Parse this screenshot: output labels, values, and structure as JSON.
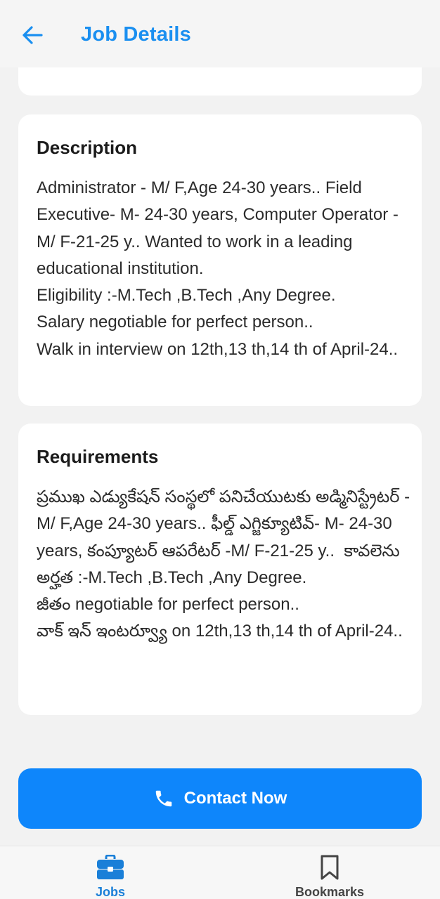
{
  "header": {
    "title": "Job Details",
    "back_icon": "arrow-left-icon",
    "accent": "#1a8ff0"
  },
  "description": {
    "heading": "Description",
    "text": "Administrator - M/ F,Age 24-30 years.. Field Executive- M- 24-30 years, Computer Operator -M/ F-21-25 y.. Wanted to work in a leading educational institution.\nEligibility :-M.Tech ,B.Tech ,Any Degree.\nSalary negotiable for perfect person..\nWalk in interview on 12th,13 th,14 th of April-24.."
  },
  "requirements": {
    "heading": "Requirements",
    "text": "ప్రముఖ ఎడ్యుకేషన్ సంస్థలో పనిచేయుటకు అడ్మినిస్ట్రేటర్ - M/ F,Age 24-30 years.. ఫీల్డ్ ఎగ్జిక్యూటివ్- M- 24-30 years, కంప్యూటర్ ఆపరేటర్ -M/ F-21-25 y..  కావలెను\nఅర్హత :-M.Tech ,B.Tech ,Any Degree.\nజీతం negotiable for perfect person..\nవాక్ ఇన్ ఇంటర్వ్యూ on 12th,13 th,14 th of April-24.."
  },
  "contact_button": {
    "label": "Contact Now",
    "icon": "phone-icon",
    "color": "#0e86fb"
  },
  "bottom_nav": {
    "items": [
      {
        "label": "Jobs",
        "icon": "briefcase-icon",
        "active": true
      },
      {
        "label": "Bookmarks",
        "icon": "bookmark-icon",
        "active": false
      }
    ]
  }
}
